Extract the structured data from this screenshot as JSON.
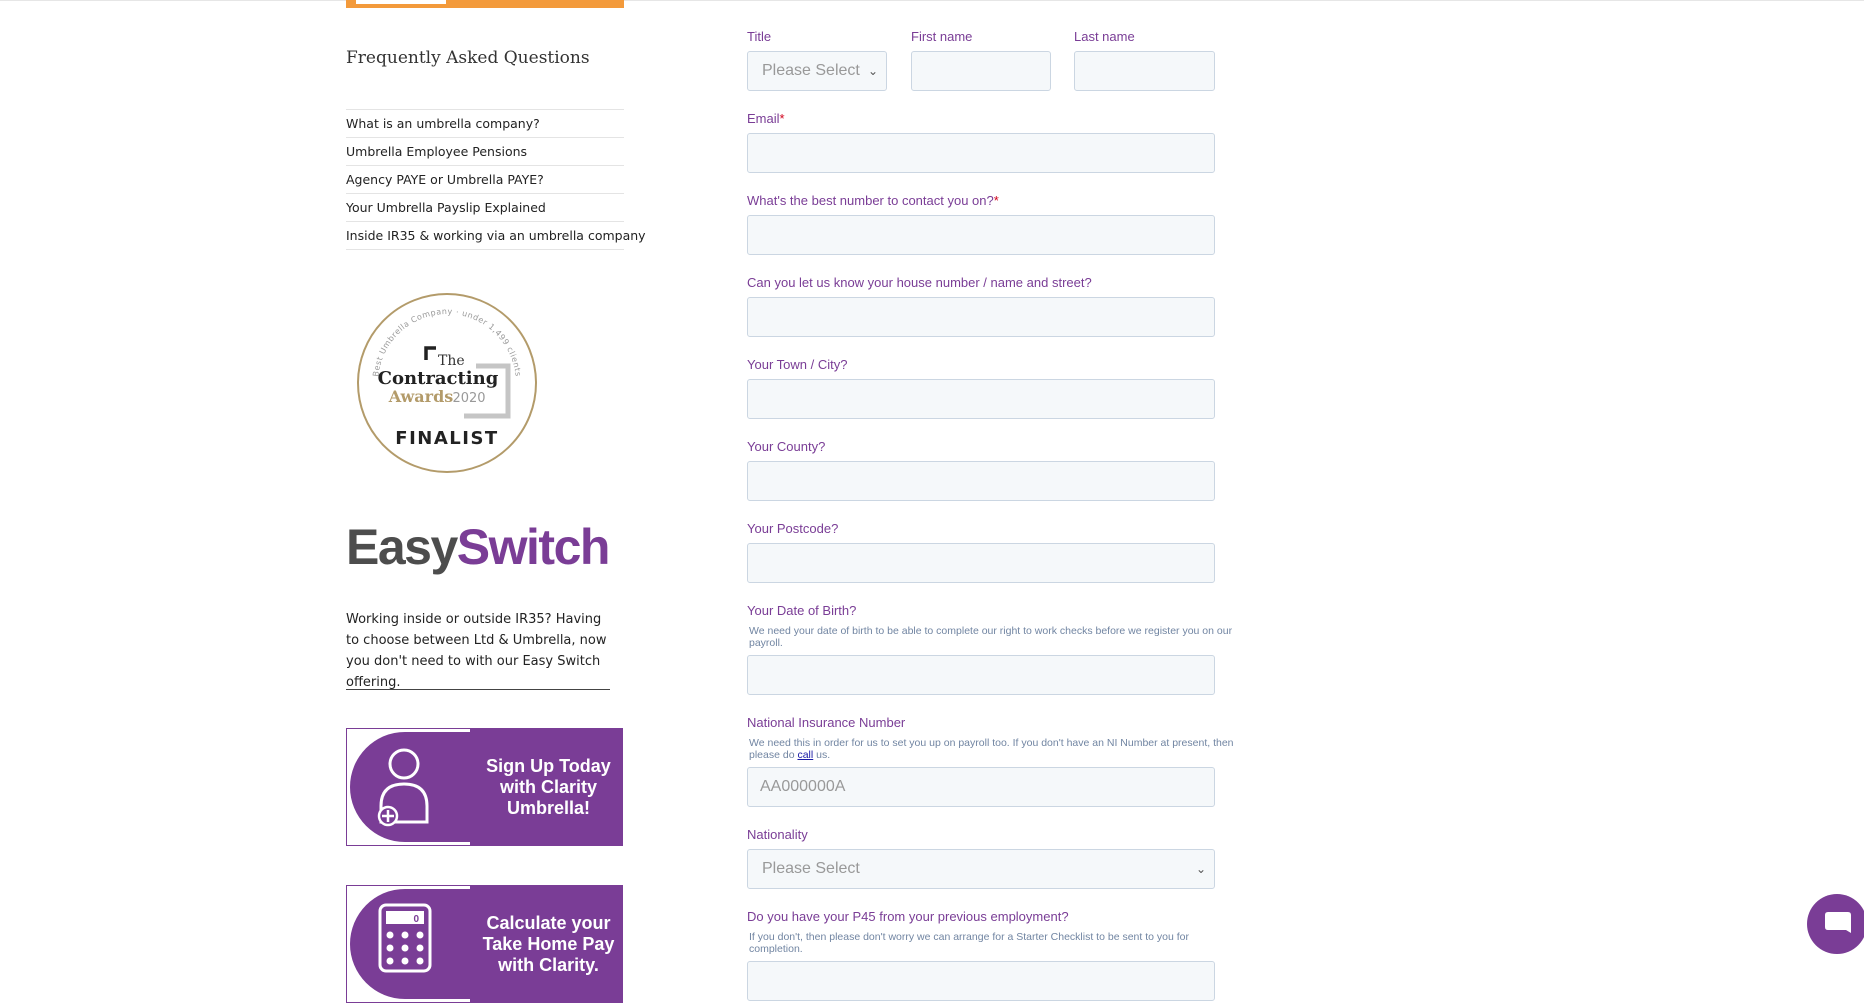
{
  "sidebar": {
    "faq_title": "Frequently Asked Questions",
    "faq_items": [
      "What is an umbrella company?",
      "Umbrella Employee Pensions",
      "Agency PAYE or Umbrella PAYE?",
      "Your Umbrella Payslip Explained",
      "Inside IR35 & working via an umbrella company"
    ],
    "award": {
      "arc_text": "Best Umbrella Company · under 1,499 clients",
      "the": "The",
      "line1": "Contracting",
      "line2": "Awards",
      "year": "2020",
      "badge": "FINALIST"
    },
    "easyswitch": {
      "easy": "Easy",
      "switch": "Switch"
    },
    "promo_text": "Working inside or outside IR35? Having to choose between Ltd & Umbrella, now you don't need to with our Easy Switch offering.",
    "banner_signup": "Sign Up Today with Clarity Umbrella!",
    "banner_calc": "Calculate your Take Home Pay with Clarity.",
    "calc_display": "0"
  },
  "form": {
    "title_label": "Title",
    "title_placeholder": "Please Select",
    "firstname_label": "First name",
    "lastname_label": "Last name",
    "email_label": "Email",
    "required_mark": "*",
    "phone_label": "What's the best number to contact you on?",
    "address_label": "Can you let us know your house number / name and street?",
    "town_label": "Your Town / City?",
    "county_label": "Your County?",
    "postcode_label": "Your Postcode?",
    "dob_label": "Your Date of Birth?",
    "dob_help": "We need your date of birth to be able to complete our right to work checks before we register you on our payroll.",
    "ni_label": "National Insurance Number",
    "ni_help_pre": "We need this in order for us to set you up on payroll too. If you don't have an NI Number at present, then please do",
    "ni_help_link": "call",
    "ni_help_post": "us.",
    "ni_placeholder": "AA000000A",
    "nationality_label": "Nationality",
    "nationality_placeholder": "Please Select",
    "p45_label": "Do you have your P45 from your previous employment?",
    "p45_help": "If you don't, then please don't worry we can arrange for a Starter Checklist to be sent to you for completion."
  },
  "colors": {
    "brand_purple": "#7a3d96",
    "accent_orange": "#f39a3b",
    "award_gold": "#b39b6a"
  }
}
